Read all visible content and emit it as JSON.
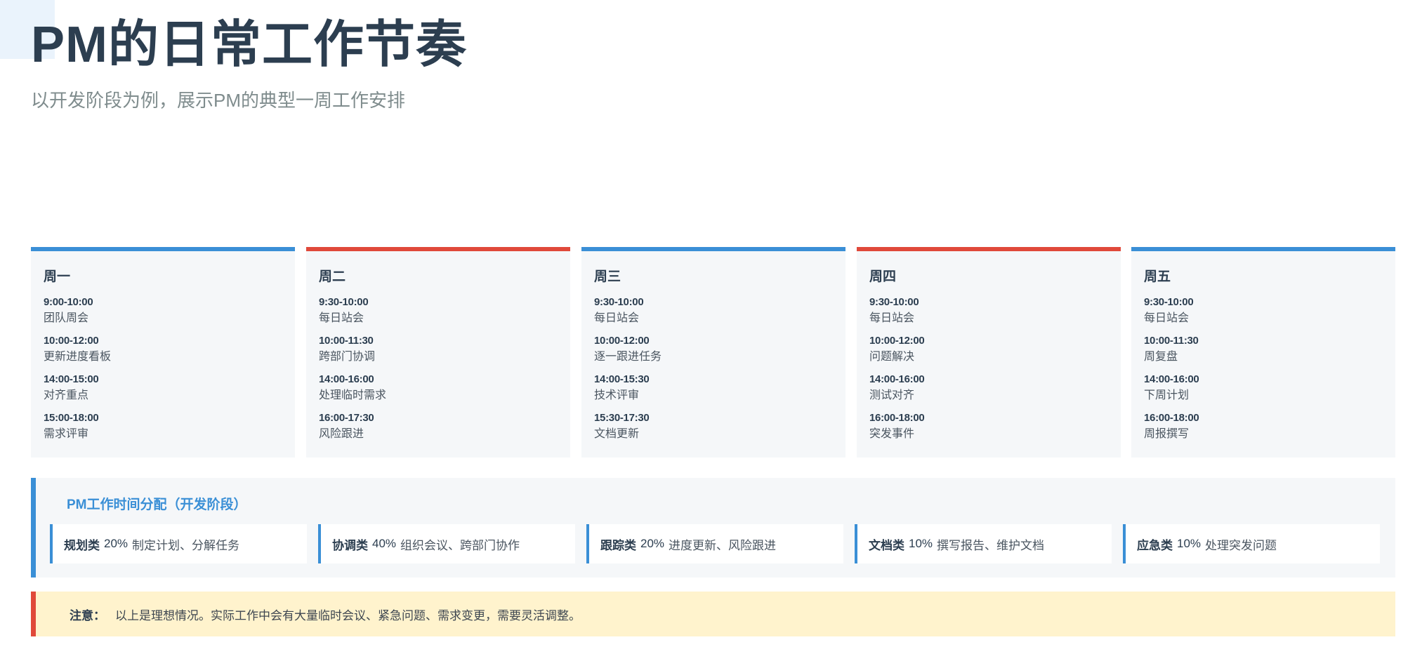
{
  "header": {
    "title": "PM的日常工作节奏",
    "subtitle": "以开发阶段为例，展示PM的典型一周工作安排"
  },
  "colors": {
    "blue": "#3a8fd6",
    "red": "#e0493a",
    "card_bg": "#f5f7f9",
    "note_bg": "#fff3cd"
  },
  "days": [
    {
      "name": "周一",
      "slots": [
        {
          "time": "9:00-10:00",
          "task": "团队周会"
        },
        {
          "time": "10:00-12:00",
          "task": "更新进度看板"
        },
        {
          "time": "14:00-15:00",
          "task": "对齐重点"
        },
        {
          "time": "15:00-18:00",
          "task": "需求评审"
        }
      ]
    },
    {
      "name": "周二",
      "slots": [
        {
          "time": "9:30-10:00",
          "task": "每日站会"
        },
        {
          "time": "10:00-11:30",
          "task": "跨部门协调"
        },
        {
          "time": "14:00-16:00",
          "task": "处理临时需求"
        },
        {
          "time": "16:00-17:30",
          "task": "风险跟进"
        }
      ]
    },
    {
      "name": "周三",
      "slots": [
        {
          "time": "9:30-10:00",
          "task": "每日站会"
        },
        {
          "time": "10:00-12:00",
          "task": "逐一跟进任务"
        },
        {
          "time": "14:00-15:30",
          "task": "技术评审"
        },
        {
          "time": "15:30-17:30",
          "task": "文档更新"
        }
      ]
    },
    {
      "name": "周四",
      "slots": [
        {
          "time": "9:30-10:00",
          "task": "每日站会"
        },
        {
          "time": "10:00-12:00",
          "task": "问题解决"
        },
        {
          "time": "14:00-16:00",
          "task": "测试对齐"
        },
        {
          "time": "16:00-18:00",
          "task": "突发事件"
        }
      ]
    },
    {
      "name": "周五",
      "slots": [
        {
          "time": "9:30-10:00",
          "task": "每日站会"
        },
        {
          "time": "10:00-11:30",
          "task": "周复盘"
        },
        {
          "time": "14:00-16:00",
          "task": "下周计划"
        },
        {
          "time": "16:00-18:00",
          "task": "周报撰写"
        }
      ]
    }
  ],
  "allocation": {
    "title": "PM工作时间分配（开发阶段）",
    "items": [
      {
        "category": "规划类",
        "percent": "20%",
        "desc": "制定计划、分解任务"
      },
      {
        "category": "协调类",
        "percent": "40%",
        "desc": "组织会议、跨部门协作"
      },
      {
        "category": "跟踪类",
        "percent": "20%",
        "desc": "进度更新、风险跟进"
      },
      {
        "category": "文档类",
        "percent": "10%",
        "desc": "撰写报告、维护文档"
      },
      {
        "category": "应急类",
        "percent": "10%",
        "desc": "处理突发问题"
      }
    ]
  },
  "note": {
    "label": "注意：",
    "text": "以上是理想情况。实际工作中会有大量临时会议、紧急问题、需求变更，需要灵活调整。"
  }
}
